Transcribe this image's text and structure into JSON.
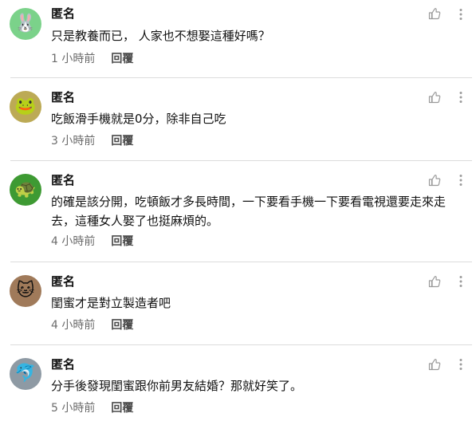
{
  "comments": [
    {
      "author": "匿名",
      "avatar_icon": "rabbit-icon",
      "avatar_glyph": "🐰",
      "avatar_color": "#7bd28a",
      "text": "只是教養而已， 人家也不想娶這種好嗎？",
      "time": "1 小時前",
      "reply": "回覆"
    },
    {
      "author": "匿名",
      "avatar_icon": "frog-icon",
      "avatar_glyph": "🐸",
      "avatar_color": "#bcaa55",
      "text": "吃飯滑手機就是0分，除非自己吃",
      "time": "3 小時前",
      "reply": "回覆"
    },
    {
      "author": "匿名",
      "avatar_icon": "turtle-icon",
      "avatar_glyph": "🐢",
      "avatar_color": "#3e9a33",
      "text": "的確是該分開，吃頓飯才多長時間，一下要看手機一下要看電視還要走來走去，這種女人娶了也挺麻煩的。",
      "time": "4 小時前",
      "reply": "回覆"
    },
    {
      "author": "匿名",
      "avatar_icon": "cat-icon",
      "avatar_glyph": "🐱",
      "avatar_color": "#a07a5a",
      "text": "閨蜜才是對立製造者吧",
      "time": "4 小時前",
      "reply": "回覆"
    },
    {
      "author": "匿名",
      "avatar_icon": "dolphin-icon",
      "avatar_glyph": "🐬",
      "avatar_color": "#8e9aa4",
      "text": "分手後發現閨蜜跟你前男友結婚？那就好笑了。",
      "time": "5 小時前",
      "reply": "回覆"
    }
  ],
  "icons": {
    "like": "thumbs-up-icon",
    "more": "more-vertical-icon"
  }
}
